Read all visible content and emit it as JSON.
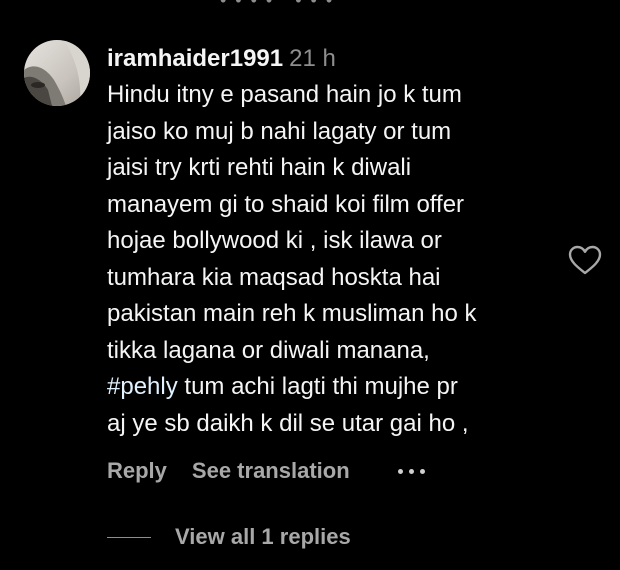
{
  "top_fragment": "• • • • , • • •",
  "comment": {
    "username": "iramhaider1991",
    "time": "21 h",
    "lines": [
      "Hindu itny e pasand hain jo k tum",
      "jaiso ko muj b nahi lagaty or tum",
      "jaisi try krti rehti hain k diwali",
      "manayem gi to shaid koi film offer",
      "hojae bollywood ki , isk ilawa or",
      "tumhara kia maqsad hoskta hai",
      "pakistan main reh k musliman ho k",
      "tikka lagana or diwali manana,"
    ],
    "hashtag": "#pehly",
    "hashtag_line_rest": " tum achi lagti thi mujhe pr",
    "last_line": "aj ye sb daikh k dil se utar gai ho ,"
  },
  "actions": {
    "reply_label": "Reply",
    "translate_label": "See translation",
    "more_icon": "more-horizontal-icon"
  },
  "like_icon": "heart-outline-icon",
  "replies": {
    "view_label": "View all 1 replies"
  },
  "colors": {
    "background": "#000000",
    "primary_text": "#f5f5f5",
    "secondary_text": "#8e8e8e",
    "action_text": "#a8a8a8",
    "hashtag": "#e0f1ff"
  }
}
